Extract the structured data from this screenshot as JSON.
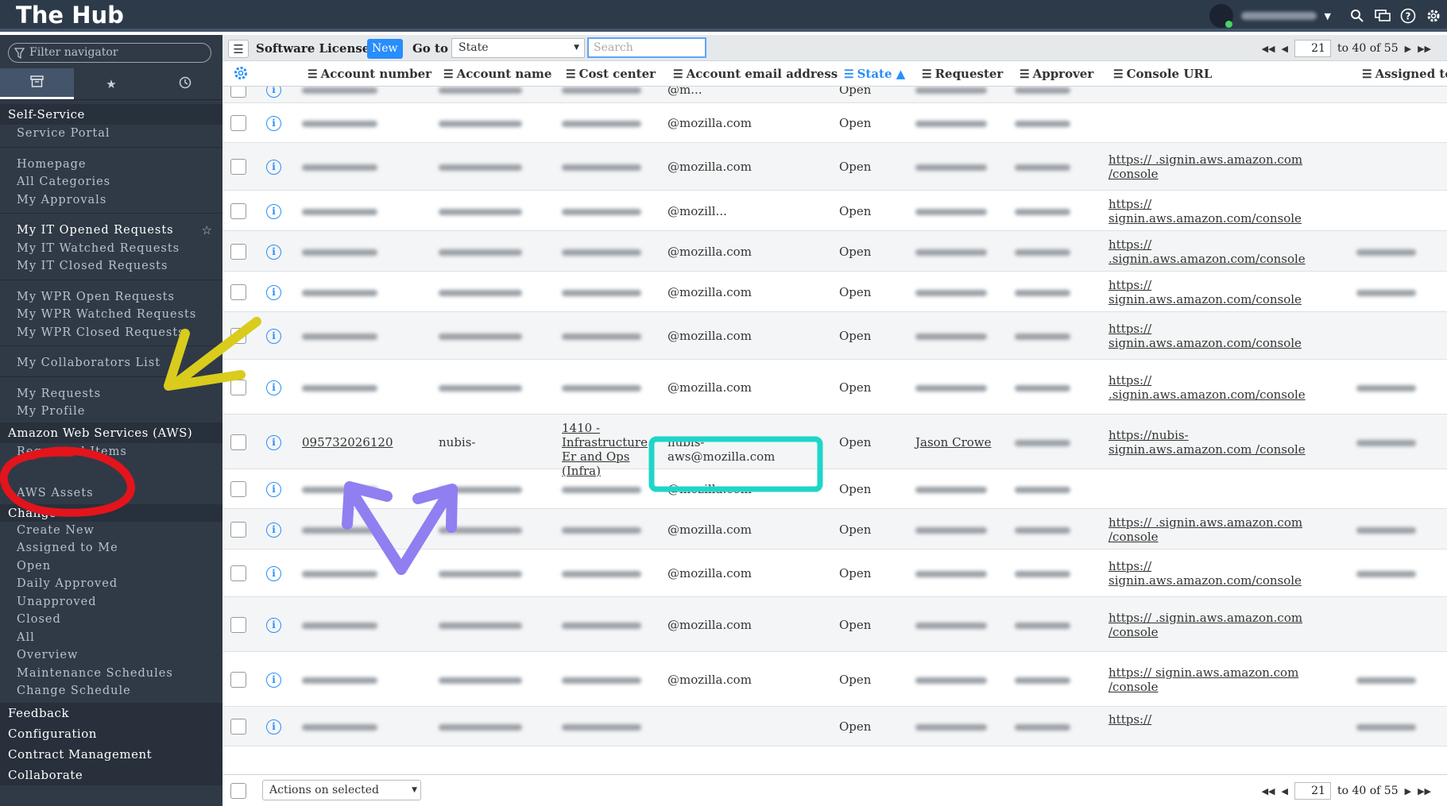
{
  "app": {
    "title": "The Hub"
  },
  "sidebar": {
    "filter_placeholder": "Filter navigator",
    "sections": [
      {
        "head": "Self-Service",
        "items": [
          "Service Portal"
        ]
      },
      {
        "items": [
          "Homepage",
          "All Categories",
          "My Approvals"
        ]
      },
      {
        "items": [
          "My IT Opened Requests",
          "My IT Watched Requests",
          "My IT Closed Requests"
        ]
      },
      {
        "items": [
          "My WPR Open Requests",
          "My WPR Watched Requests",
          "My WPR Closed Requests"
        ]
      },
      {
        "items": [
          "My Collaborators List"
        ]
      },
      {
        "items": [
          "My Requests",
          "My Profile"
        ]
      },
      {
        "head": "Amazon Web Services (AWS)",
        "items": [
          "Requested Items",
          "",
          "AWS Assets"
        ]
      },
      {
        "head": "Change",
        "items": [
          "Create New",
          "Assigned to Me",
          "Open",
          "Daily Approved",
          "Unapproved",
          "Closed",
          "All",
          "Overview",
          "Maintenance Schedules",
          "Change Schedule"
        ]
      }
    ],
    "bottom": [
      "Feedback",
      "Configuration",
      "Contract Management",
      "Collaborate"
    ]
  },
  "listbar": {
    "title": "Software Licenses",
    "new_label": "New",
    "goto_label": "Go to",
    "goto_value": "State",
    "search_placeholder": "Search",
    "page": "21",
    "range": "to 40 of 55"
  },
  "columns": [
    "Account number",
    "Account name",
    "Cost center",
    "Account email address",
    "State",
    "Requester",
    "Approver",
    "Console URL",
    "Assigned to"
  ],
  "rows": [
    {
      "email": "@m...",
      "state": "Open",
      "console": ""
    },
    {
      "email": "@mozilla.com",
      "state": "Open",
      "console": ""
    },
    {
      "email": "@mozilla.com",
      "state": "Open",
      "console": "https:// .signin.aws.amazon.com /console"
    },
    {
      "email": "@mozill...",
      "state": "Open",
      "console": "https:// signin.aws.amazon.com/console"
    },
    {
      "email": "@mozilla.com",
      "state": "Open",
      "console": "https:// .signin.aws.amazon.com/console"
    },
    {
      "email": "@mozilla.com",
      "state": "Open",
      "console": "https:// signin.aws.amazon.com/console"
    },
    {
      "email": "@mozilla.com",
      "state": "Open",
      "console": "https:// signin.aws.amazon.com/console"
    },
    {
      "email": "@mozilla.com",
      "state": "Open",
      "console": "https:// .signin.aws.amazon.com/console"
    },
    {
      "number": "095732026120",
      "name": "nubis-",
      "cost_center": "1410 - Infrastructure Er and Ops (Infra)",
      "email": "nubis- aws@mozilla.com",
      "state": "Open",
      "requester": "Jason Crowe",
      "console": "https://nubis- signin.aws.amazon.com /console"
    },
    {
      "email": "@mozilla.com",
      "state": "Open",
      "console": ""
    },
    {
      "email": "@mozilla.com",
      "state": "Open",
      "console": "https:// .signin.aws.amazon.com /console"
    },
    {
      "email": "@mozilla.com",
      "state": "Open",
      "console": "https:// signin.aws.amazon.com/console"
    },
    {
      "email": "@mozilla.com",
      "state": "Open",
      "console": "https:// .signin.aws.amazon.com /console"
    },
    {
      "email": "@mozilla.com",
      "state": "Open",
      "console": "https:// signin.aws.amazon.com /console"
    },
    {
      "email": "",
      "state": "Open",
      "console": "https://"
    }
  ],
  "footer": {
    "actions_label": "Actions on selected rows...",
    "page": "21",
    "range": "to 40 of 55"
  },
  "colors": {
    "accent": "#278efc",
    "banner": "#2d3a4a",
    "sidebar": "#303a46",
    "annot_yellow": "#d9cc1c",
    "annot_red": "#e3141c",
    "annot_purple": "#8f7ff0",
    "annot_cyan": "#1ed6c8"
  }
}
